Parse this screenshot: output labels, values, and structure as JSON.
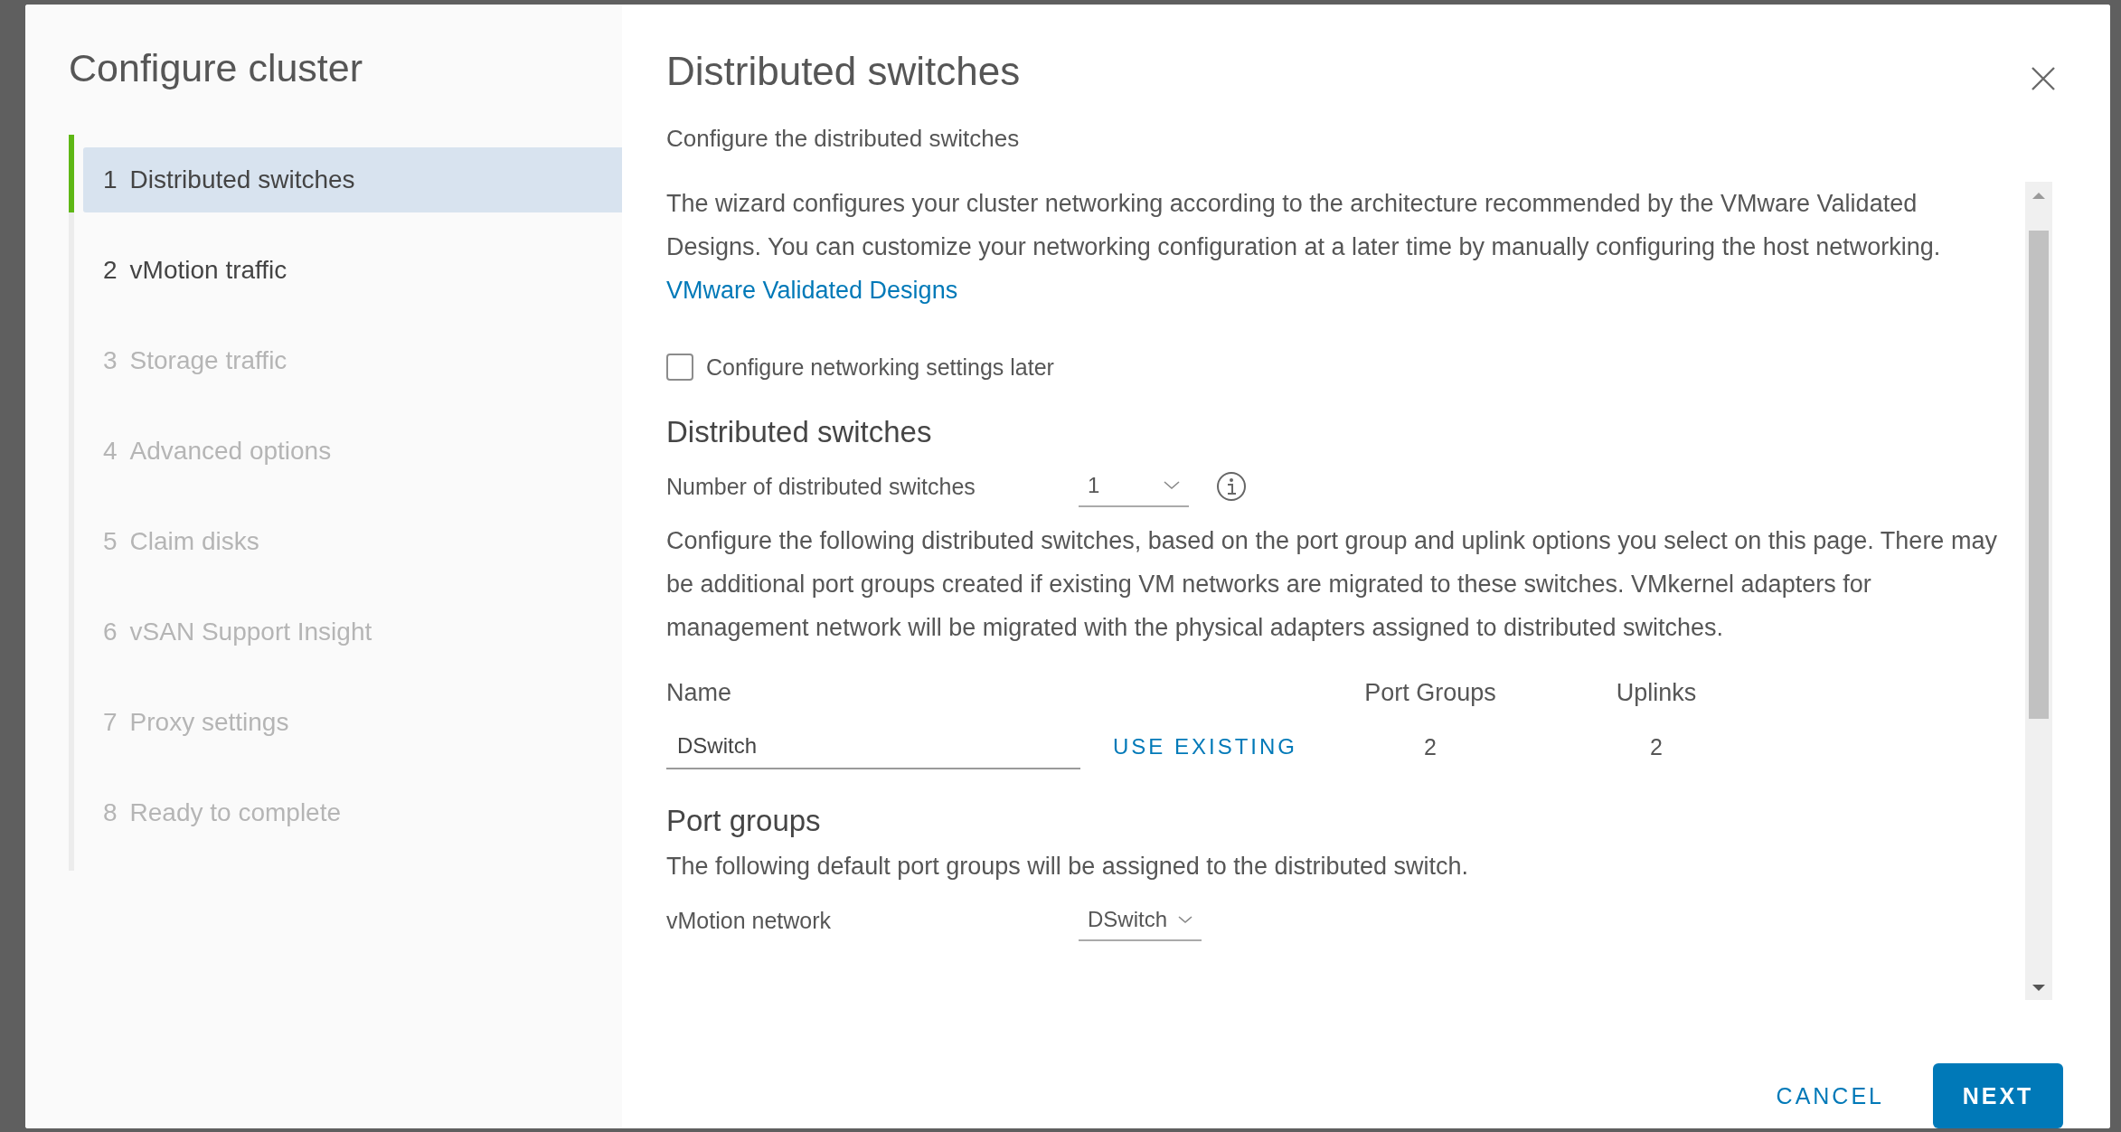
{
  "dialog": {
    "title": "Configure cluster",
    "steps": [
      {
        "number": "1",
        "label": "Distributed switches",
        "selected": true,
        "disabled": false
      },
      {
        "number": "2",
        "label": "vMotion traffic",
        "selected": false,
        "disabled": false
      },
      {
        "number": "3",
        "label": "Storage traffic",
        "selected": false,
        "disabled": true
      },
      {
        "number": "4",
        "label": "Advanced options",
        "selected": false,
        "disabled": true
      },
      {
        "number": "5",
        "label": "Claim disks",
        "selected": false,
        "disabled": true
      },
      {
        "number": "6",
        "label": "vSAN Support Insight",
        "selected": false,
        "disabled": true
      },
      {
        "number": "7",
        "label": "Proxy settings",
        "selected": false,
        "disabled": true
      },
      {
        "number": "8",
        "label": "Ready to complete",
        "selected": false,
        "disabled": true
      }
    ]
  },
  "page": {
    "title": "Distributed switches",
    "subtitle": "Configure the distributed switches",
    "intro": "The wizard configures your cluster networking according to the architecture recommended by the VMware Validated Designs. You can customize your networking configuration at a later time by manually configuring the host networking.",
    "intro_link": "VMware Validated Designs",
    "later_checkbox": {
      "label": "Configure networking settings later",
      "checked": false
    },
    "switches_heading": "Distributed switches",
    "switch_count": {
      "label": "Number of distributed switches",
      "value": "1"
    },
    "switches_text": "Configure the following distributed switches, based on the port group and uplink options you select on this page. There may be additional port groups created if existing VM networks are migrated to these switches. VMkernel adapters for management network will be migrated with the physical adapters assigned to distributed switches.",
    "table": {
      "columns": [
        "Name",
        "Port Groups",
        "Uplinks"
      ],
      "rows": [
        {
          "name": "DSwitch",
          "action": "USE EXISTING",
          "port_groups": "2",
          "uplinks": "2"
        }
      ]
    },
    "port_groups_heading": "Port groups",
    "port_groups_text": "The following default port groups will be assigned to the distributed switch.",
    "port_group_rows": [
      {
        "label": "vMotion network",
        "value": "DSwitch"
      }
    ]
  },
  "buttons": {
    "cancel": "CANCEL",
    "next": "NEXT"
  }
}
